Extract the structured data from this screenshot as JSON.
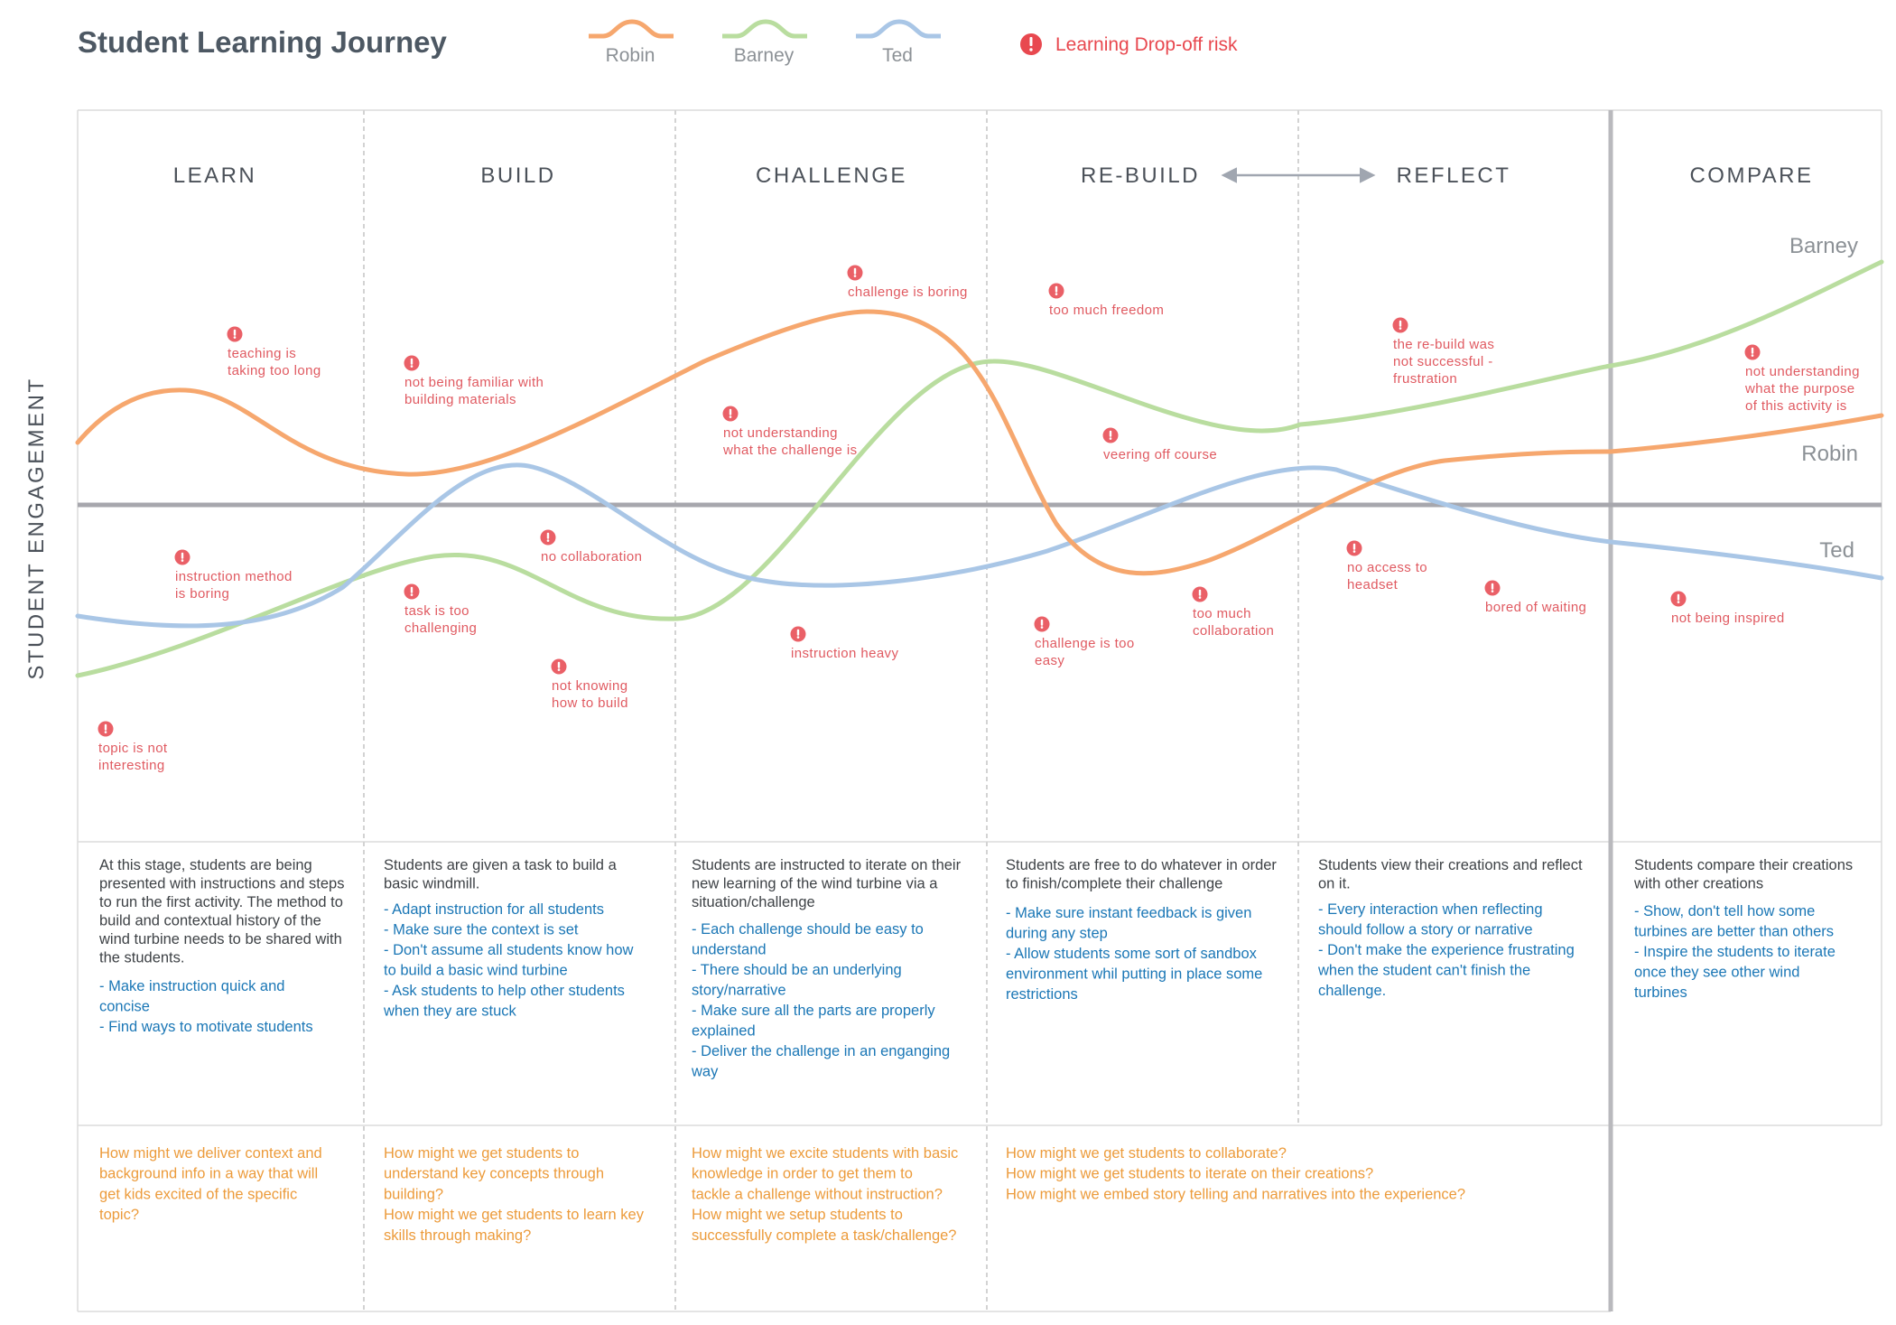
{
  "title": "Student Learning Journey",
  "legend": {
    "series": [
      {
        "name": "Robin",
        "color": "#f6a76e"
      },
      {
        "name": "Barney",
        "color": "#b9dd9f"
      },
      {
        "name": "Ted",
        "color": "#a9c6e6"
      }
    ],
    "risk_label": "Learning Drop-off risk",
    "risk_icon": "exclamation-circle-icon",
    "risk_color": "#e8484f"
  },
  "y_axis_label": "STUDENT ENGAGEMENT",
  "phases": [
    "LEARN",
    "BUILD",
    "CHALLENGE",
    "RE-BUILD",
    "REFLECT",
    "COMPARE"
  ],
  "series_end_labels": [
    "Barney",
    "Robin",
    "Ted"
  ],
  "risks": [
    {
      "text": [
        "teaching is",
        "taking too long"
      ]
    },
    {
      "text": [
        "instruction method",
        "is boring"
      ]
    },
    {
      "text": [
        "topic is not",
        "interesting"
      ]
    },
    {
      "text": [
        "not being familiar with",
        "building materials"
      ]
    },
    {
      "text": [
        "task is too",
        "challenging"
      ]
    },
    {
      "text": [
        "no collaboration"
      ]
    },
    {
      "text": [
        "not knowing",
        "how to build"
      ]
    },
    {
      "text": [
        "challenge is boring"
      ]
    },
    {
      "text": [
        "not understanding",
        "what the challenge is"
      ]
    },
    {
      "text": [
        "instruction heavy"
      ]
    },
    {
      "text": [
        "too much freedom"
      ]
    },
    {
      "text": [
        "veering off course"
      ]
    },
    {
      "text": [
        "challenge is too",
        "easy"
      ]
    },
    {
      "text": [
        "too much",
        "collaboration"
      ]
    },
    {
      "text": [
        "the re-build was",
        "not successful -",
        "frustration"
      ]
    },
    {
      "text": [
        "no access to",
        "headset"
      ]
    },
    {
      "text": [
        "bored of waiting"
      ]
    },
    {
      "text": [
        "not understanding",
        "what the purpose",
        "of this activity is"
      ]
    },
    {
      "text": [
        "not being inspired"
      ]
    }
  ],
  "descriptions": [
    {
      "desc": [
        "At this stage, students are being",
        "presented with instructions and steps",
        "to run the first activity. The method to",
        "build and contextual history of the",
        "wind turbine needs to be shared with",
        "the students."
      ],
      "recs": [
        "- Make instruction quick and",
        "concise",
        "- Find ways to motivate students"
      ]
    },
    {
      "desc": [
        "Students are given a task to build a",
        "basic windmill."
      ],
      "recs": [
        "- Adapt instruction for all students",
        "- Make sure the context is set",
        "- Don't assume all students know how",
        "to build a basic wind turbine",
        "- Ask students to help other students",
        "when they are stuck"
      ]
    },
    {
      "desc": [
        "Students are instructed to iterate on their",
        "new learning of the wind turbine via a",
        "situation/challenge"
      ],
      "recs": [
        "- Each challenge should be easy to",
        "understand",
        "- There should be an underlying",
        "story/narrative",
        "- Make sure all the parts are properly",
        "explained",
        "- Deliver the challenge in an enganging",
        "way"
      ]
    },
    {
      "desc": [
        "Students are free to do whatever in order",
        "to finish/complete their challenge"
      ],
      "recs": [
        "- Make sure instant feedback is given",
        "during any step",
        "- Allow students some sort of sandbox",
        "environment whil putting in place some",
        "restrictions"
      ]
    },
    {
      "desc": [
        "Students view their creations and reflect",
        "on it."
      ],
      "recs": [
        "- Every interaction when reflecting",
        "should follow a story or narrative",
        "- Don't make the experience frustrating",
        "when the student can't finish the",
        "challenge."
      ]
    },
    {
      "desc": [
        "Students compare their creations",
        "with other creations"
      ],
      "recs": [
        "- Show, don't tell how some",
        "turbines are better than others",
        "- Inspire the students to iterate",
        "once they see other wind",
        "turbines"
      ]
    }
  ],
  "hmw": [
    [
      "How might we deliver context and",
      "background info in a way that will",
      "get kids excited of the specific",
      "topic?"
    ],
    [
      "How might we get students to",
      "understand key concepts through",
      "building?",
      "",
      "How might we get students to learn key",
      "skills through making?"
    ],
    [
      "How might we excite students with basic",
      "knowledge in order to get them to",
      "tackle a challenge without instruction?",
      "",
      "How might we setup students to",
      "successfully complete a task/challenge?"
    ],
    [
      "How might we get students to collaborate?",
      "",
      "How might we get students to iterate on their creations?",
      "",
      "How might we embed story telling and narratives into the experience?"
    ]
  ]
}
